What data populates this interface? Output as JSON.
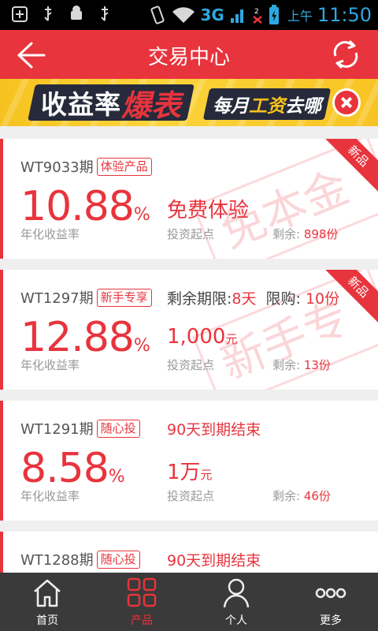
{
  "status_bar": {
    "network": "3G",
    "notification_count": "2",
    "ampm": "上午",
    "time": "11:50"
  },
  "header": {
    "title": "交易中心"
  },
  "banner": {
    "text_part1": "收益率",
    "text_part2": "爆表",
    "right_text_a": "每月",
    "right_text_b": "工资",
    "right_text_c": "去哪"
  },
  "products": [
    {
      "period": "WT9033期",
      "tag": "体验产品",
      "rate": "10.88",
      "pct": "%",
      "rate_label": "年化收益率",
      "amount": "免费体验",
      "amount_unit": "",
      "amount_label": "投资起点",
      "remaining_label": "剩余:",
      "remaining": "898份",
      "ribbon": "新品",
      "stamp": "免本金"
    },
    {
      "period": "WT1297期",
      "tag": "新手专享",
      "info_a_label": "剩余期限:",
      "info_a_value": "8天",
      "info_b_label": "限购:",
      "info_b_value": "10份",
      "rate": "12.88",
      "pct": "%",
      "rate_label": "年化收益率",
      "amount": "1,000",
      "amount_unit": "元",
      "amount_label": "投资起点",
      "remaining_label": "剩余:",
      "remaining": "13份",
      "ribbon": "新品",
      "stamp": "新手专享"
    },
    {
      "period": "WT1291期",
      "tag": "随心投",
      "info": "90天到期结束",
      "rate": "8.58",
      "pct": "%",
      "rate_label": "年化收益率",
      "amount": "1万",
      "amount_unit": "元",
      "amount_label": "投资起点",
      "remaining_label": "剩余:",
      "remaining": "46份"
    },
    {
      "period": "WT1288期",
      "tag": "随心投",
      "info": "90天到期结束"
    }
  ],
  "nav": [
    {
      "label": "首页",
      "icon": "home-icon"
    },
    {
      "label": "产品",
      "icon": "grid-icon",
      "active": true
    },
    {
      "label": "个人",
      "icon": "person-icon"
    },
    {
      "label": "更多",
      "icon": "more-icon"
    }
  ],
  "colors": {
    "primary": "#e8343d",
    "nav_bg": "#3a3a3a",
    "banner_yellow": "#f6c21f"
  }
}
